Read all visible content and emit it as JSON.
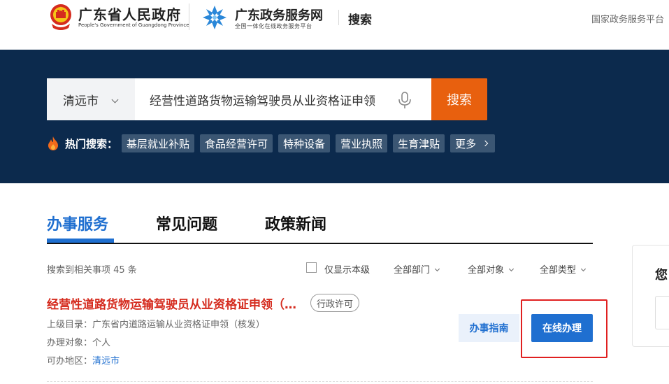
{
  "header": {
    "gov_title": "广东省人民政府",
    "gov_subtitle": "People's Government of Guangdong Province",
    "portal_title": "广东政务服务网",
    "portal_subtitle": "全国一体化在线政务服务平台",
    "page_title": "搜索",
    "national_link": "国家政务服务平台"
  },
  "search": {
    "city": "清远市",
    "query": "经营性道路货物运输驾驶员从业资格证申领",
    "button_label": "搜索"
  },
  "hot": {
    "label": "热门搜索：",
    "tags": [
      "基层就业补贴",
      "食品经营许可",
      "特种设备",
      "营业执照",
      "生育津贴"
    ],
    "more": "更多"
  },
  "tabs": [
    {
      "label": "办事服务",
      "active": true
    },
    {
      "label": "常见问题",
      "active": false
    },
    {
      "label": "政策新闻",
      "active": false
    }
  ],
  "filters": {
    "result_count": "搜索到相关事项 45 条",
    "only_this_level": "仅显示本级",
    "department": "全部部门",
    "target": "全部对象",
    "type": "全部类型"
  },
  "item": {
    "title": "经营性道路货物运输驾驶员从业资格证申领（核发）",
    "tag": "行政许可",
    "parent_label": "上级目录：",
    "parent_value": "广东省内道路运输从业资格证申领（核发）",
    "target_label": "办理对象：",
    "target_value": "个人",
    "region_label": "可办地区：",
    "region_value": "清远市",
    "guide_button": "办事指南",
    "handle_button": "在线办理"
  },
  "side": {
    "text": "您"
  },
  "colors": {
    "banner": "#0c2a4d",
    "accent_orange": "#e8600e",
    "accent_blue": "#1f6fd0",
    "title_red": "#d52b1e",
    "highlight_box": "#e02020"
  }
}
